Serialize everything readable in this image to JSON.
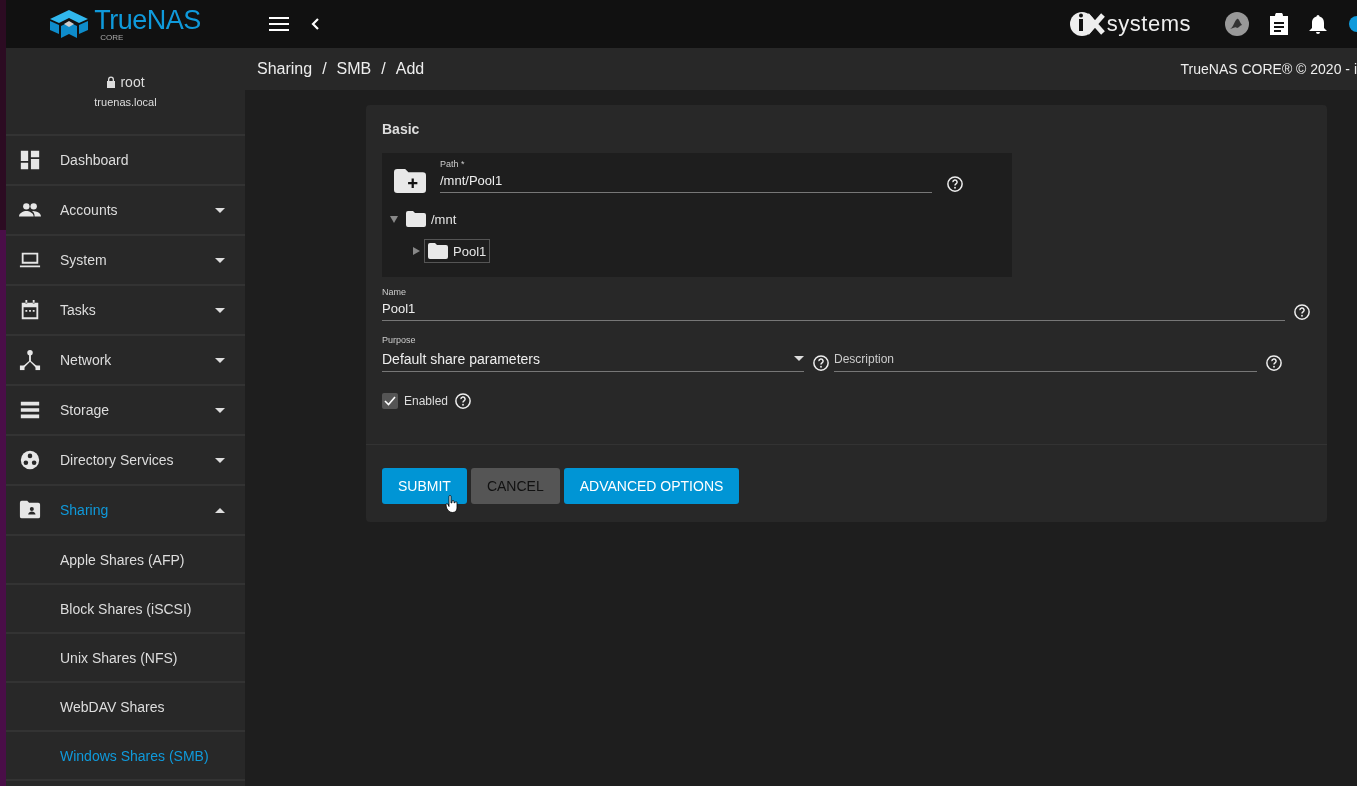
{
  "topbar": {
    "logo_text": "TrueNAS",
    "logo_sub": "CORE",
    "vendor": "systems"
  },
  "user": {
    "name": "root",
    "host": "truenas.local"
  },
  "sidebar": {
    "items": [
      {
        "label": "Dashboard",
        "selected": false
      },
      {
        "label": "Accounts",
        "expanded": false,
        "selected": false
      },
      {
        "label": "System",
        "expanded": false,
        "selected": false
      },
      {
        "label": "Tasks",
        "expanded": false,
        "selected": false
      },
      {
        "label": "Network",
        "expanded": false,
        "selected": false
      },
      {
        "label": "Storage",
        "expanded": false,
        "selected": false
      },
      {
        "label": "Directory Services",
        "expanded": false,
        "selected": false
      },
      {
        "label": "Sharing",
        "expanded": true,
        "selected": true,
        "children": [
          {
            "label": "Apple Shares (AFP)",
            "selected": false
          },
          {
            "label": "Block Shares (iSCSI)",
            "selected": false
          },
          {
            "label": "Unix Shares (NFS)",
            "selected": false
          },
          {
            "label": "WebDAV Shares",
            "selected": false
          },
          {
            "label": "Windows Shares (SMB)",
            "selected": true
          }
        ]
      }
    ]
  },
  "breadcrumb": [
    "Sharing",
    "/",
    "SMB",
    "/",
    "Add"
  ],
  "copyright": "TrueNAS CORE® © 2020 - i",
  "form": {
    "section": "Basic",
    "path": {
      "label": "Path *",
      "value": "/mnt/Pool1"
    },
    "tree": [
      {
        "label": "/mnt",
        "expanded": true,
        "selected": false,
        "children": [
          {
            "label": "Pool1",
            "expanded": false,
            "selected": true
          }
        ]
      }
    ],
    "name": {
      "label": "Name",
      "value": "Pool1"
    },
    "purpose": {
      "label": "Purpose",
      "value": "Default share parameters"
    },
    "description": {
      "placeholder": "Description"
    },
    "enabled": {
      "label": "Enabled",
      "checked": true
    },
    "buttons": [
      {
        "label": "SUBMIT",
        "kind": "primary"
      },
      {
        "label": "CANCEL",
        "kind": "secondary"
      },
      {
        "label": "ADVANCED OPTIONS",
        "kind": "primary"
      }
    ]
  }
}
